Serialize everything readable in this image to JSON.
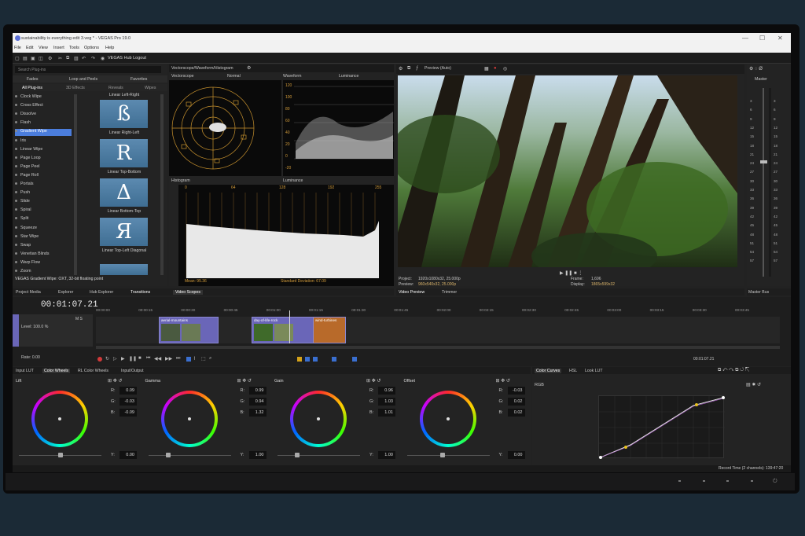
{
  "window": {
    "title": "sustainability is everything edit 3.veg * - VEGAS Pro 19.0",
    "controls": [
      "—",
      "☐",
      "✕"
    ]
  },
  "menu": [
    "File",
    "Edit",
    "View",
    "Insert",
    "Tools",
    "Options",
    "Help"
  ],
  "toolbar": {
    "hub_label": "VEGAS Hub Logout"
  },
  "plugin_panel": {
    "search_placeholder": "Search Plug-ins",
    "tabs_top": [
      "Fades",
      "Loop and Peels",
      "Favorites"
    ],
    "tabs_bottom": [
      "All Plug-ins",
      "3D Effects",
      "Reveals",
      "Wipes"
    ],
    "items": [
      "Clock Wipe",
      "Cross Effect",
      "Dissolve",
      "Flash",
      "Gradient Wipe",
      "Iris",
      "Linear Wipe",
      "Page Loop",
      "Page Peel",
      "Page Roll",
      "Portals",
      "Push",
      "Slide",
      "Spiral",
      "Split",
      "Squeeze",
      "Star Wipe",
      "Swap",
      "Venetian Blinds",
      "Warp Flow",
      "Zoom"
    ],
    "selected": "Gradient Wipe",
    "presets": [
      "Linear Right-Left",
      "Linear Top-Bottom",
      "Linear Bottom-Top",
      "Linear Top-Left Diagonal"
    ],
    "preset_top_label": "Linear Left-Right",
    "status": "VEGAS Gradient Wipe: OXT, 32-bit floating point"
  },
  "scopes": {
    "dropdown": "Vectorscope/Waveform/Histogram",
    "vectorscope_label": "Vectorscope",
    "vectorscope_mode": "Normal",
    "waveform_label": "Waveform",
    "waveform_mode": "Luminance",
    "waveform_y": [
      "120",
      "100",
      "80",
      "60",
      "40",
      "20",
      "0",
      "-20"
    ],
    "histogram_label": "Histogram",
    "histogram_mode": "Luminance",
    "histogram_x": [
      "0",
      "64",
      "128",
      "192",
      "255"
    ],
    "mean": "Mean: 95.36",
    "std": "Standard Deviation: 67.09"
  },
  "preview": {
    "mode": "Preview (Auto)",
    "project_label": "Project:",
    "project_value": "1920x1080x32, 25.000p",
    "preview_label": "Preview:",
    "preview_value": "960x540x32, 25.000p",
    "frame_label": "Frame:",
    "frame_value": "1,696",
    "display_label": "Display:",
    "display_value": "1865x599x32"
  },
  "master": {
    "label": "Master",
    "scale": [
      "3",
      "6",
      "9",
      "12",
      "15",
      "18",
      "21",
      "24",
      "27",
      "30",
      "33",
      "36",
      "39",
      "42",
      "45",
      "48",
      "51",
      "54",
      "57"
    ]
  },
  "window_tabs": [
    "Project Media",
    "Explorer",
    "Hub Explorer",
    "Transitions",
    "Video Scopes"
  ],
  "preview_tabs": [
    "Video Preview",
    "Trimmer"
  ],
  "master_bus": "Master Bus",
  "timeline": {
    "timecode": "00:01:07.21",
    "level": "Level: 100.0 %",
    "rate": "Rate: 0.00",
    "ruler": [
      "00:00:00",
      "00:00:15",
      "00:00:30",
      "00:00:45",
      "00:01:00",
      "00:01:15",
      "00:01:30",
      "00:01:45",
      "00:02:00",
      "00:02:15",
      "00:02:30",
      "00:02:45",
      "00:03:00",
      "00:03:15",
      "00:03:30",
      "00:03:45"
    ],
    "clips": [
      "aerial-mountains",
      "day-of-life-rock",
      "wind-turbines"
    ],
    "end_time": "00:01:07.21"
  },
  "color_tabs_left": [
    "Input LUT",
    "Color Wheels",
    "RL Color Wheels",
    "Input/Output"
  ],
  "color_tabs_right": [
    "Color Curves",
    "HSL",
    "Look LUT"
  ],
  "wheels": [
    {
      "name": "Lift",
      "r": "0.09",
      "g": "-0.03",
      "b": "-0.09",
      "y": "0.00"
    },
    {
      "name": "Gamma",
      "r": "0.99",
      "g": "0.94",
      "b": "1.32",
      "y": "1.00"
    },
    {
      "name": "Gain",
      "r": "0.96",
      "g": "1.03",
      "b": "1.01",
      "y": "1.00"
    },
    {
      "name": "Offset",
      "r": "-0.03",
      "g": "0.02",
      "b": "0.02",
      "y": "0.00"
    }
  ],
  "curves": {
    "channel": "RGB"
  },
  "status_bar": "Record Time (2 channels): 139:47:20",
  "colors": {
    "accent": "#4b7ddc",
    "clip": "#6a66b8",
    "scope_grid": "#d39c3b"
  }
}
